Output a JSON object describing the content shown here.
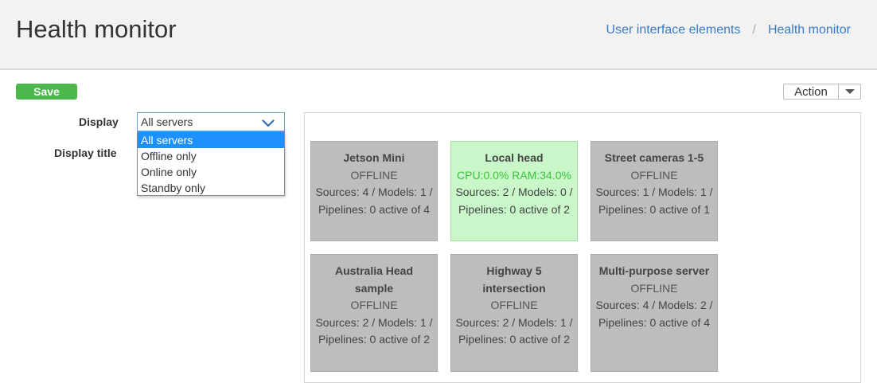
{
  "header": {
    "title": "Health monitor",
    "breadcrumb": [
      "User interface elements",
      "Health monitor"
    ],
    "separator": "/"
  },
  "toolbar": {
    "save_label": "Save",
    "action_label": "Action",
    "action_caret_icon": "caret-down-icon"
  },
  "form": {
    "display_label": "Display",
    "display_title_label": "Display title",
    "display_select": {
      "value": "All servers",
      "icon": "chevron-down-icon",
      "options": [
        "All servers",
        "Offline only",
        "Online only",
        "Standby only"
      ],
      "selected_index": 0
    }
  },
  "servers": [
    {
      "name": "Jetson Mini",
      "status": "OFFLINE",
      "stats": "Sources: 4 / Models: 1 / Pipelines: 0 active of 4",
      "online": false
    },
    {
      "name": "Local head",
      "status": "CPU:0.0% RAM:34.0%",
      "stats": "Sources: 2 / Models: 0 / Pipelines: 0 active of 2",
      "online": true
    },
    {
      "name": "Street cameras 1-5",
      "status": "OFFLINE",
      "stats": "Sources: 1 / Models: 1 / Pipelines: 0 active of 1",
      "online": false
    },
    {
      "name": "Australia Head sample",
      "status": "OFFLINE",
      "stats": "Sources: 2 / Models: 1 / Pipelines: 0 active of 2",
      "online": false
    },
    {
      "name": "Highway 5 intersection",
      "status": "OFFLINE",
      "stats": "Sources: 2 / Models: 1 / Pipelines: 0 active of 2",
      "online": false
    },
    {
      "name": "Multi-purpose server",
      "status": "OFFLINE",
      "stats": "Sources: 4 / Models: 2 / Pipelines: 0 active of 4",
      "online": false
    }
  ],
  "colors": {
    "accent": "#3a7bc8",
    "save": "#4cb84c",
    "offline_card": "#bdbdbd",
    "online_card": "#c9f7c9",
    "online_text": "#3cc23c",
    "selected_option": "#1e90ff"
  }
}
